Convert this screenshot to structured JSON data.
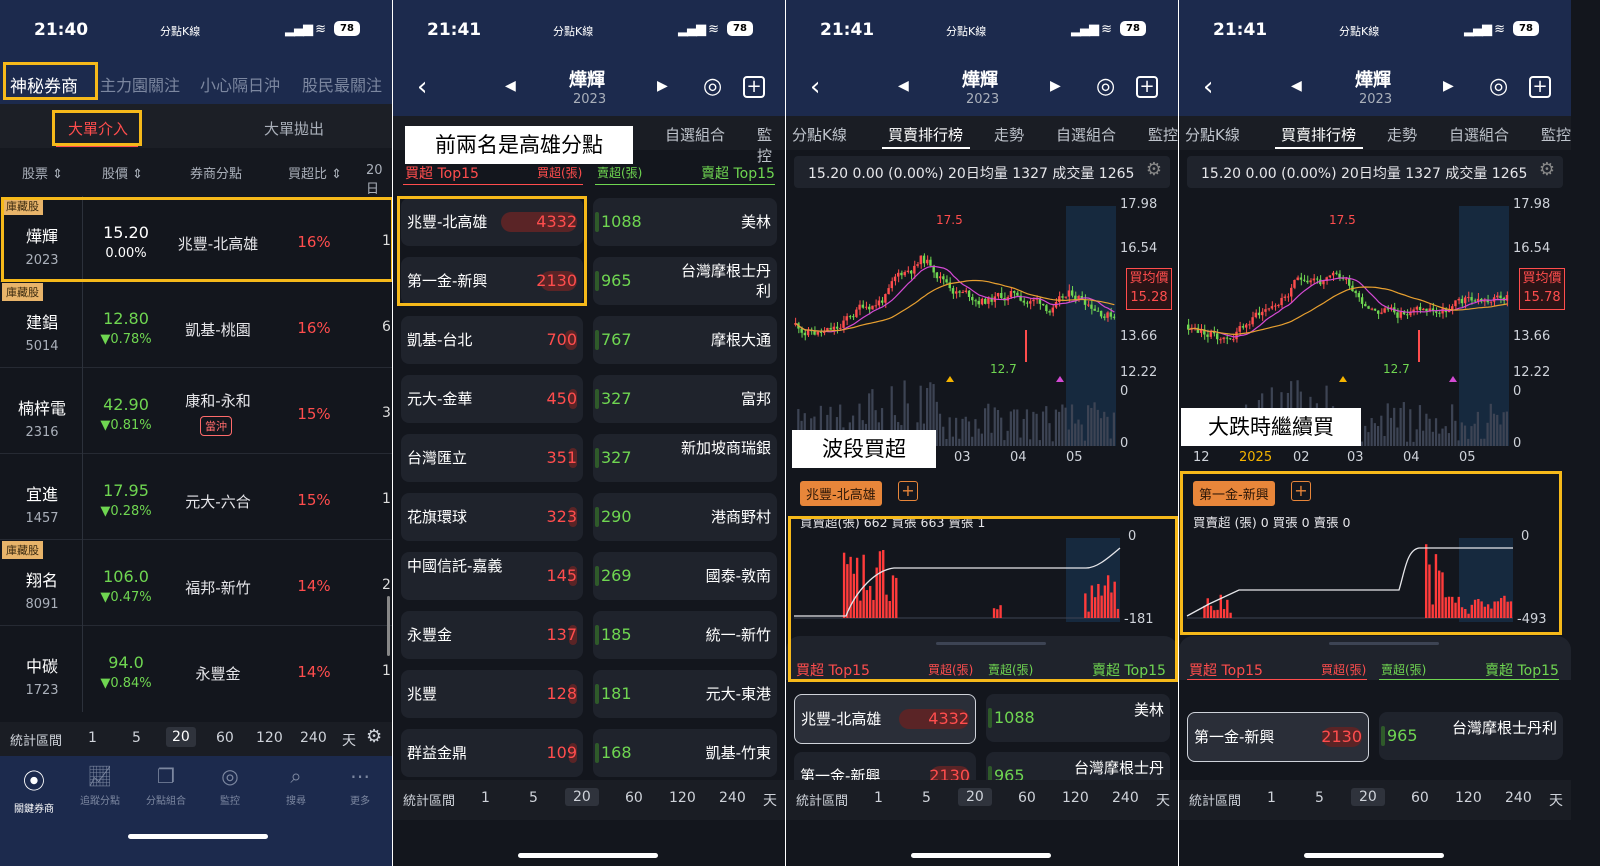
{
  "status": {
    "time1": "21:40",
    "time2": "21:41",
    "app": "分點K線",
    "battery": "78",
    "signal": "▂▄▆ ≋"
  },
  "p1": {
    "tabs": [
      "神秘券商",
      "主力園關注",
      "小心隔日沖",
      "股民最關注"
    ],
    "subtabs": [
      "大單介入",
      "大單拋出"
    ],
    "headers": [
      "股票 ⇕",
      "股價 ⇕",
      "券商分點",
      "買超比 ⇕",
      "20日"
    ],
    "rows": [
      {
        "tag": "庫藏股",
        "name": "燁輝",
        "code": "2023",
        "price": "15.20",
        "chg": "0.00%",
        "broker": "兆豐-北高雄",
        "ratio": "16%",
        "extra": "1:"
      },
      {
        "tag": "庫藏股",
        "name": "建錩",
        "code": "5014",
        "price": "12.80",
        "chg": "▼0.78%",
        "broker": "凱基-桃園",
        "ratio": "16%",
        "extra": "6"
      },
      {
        "tag": "",
        "name": "楠梓電",
        "code": "2316",
        "price": "42.90",
        "chg": "▼0.81%",
        "broker": "康和-永和",
        "badge": "當沖",
        "ratio": "15%",
        "extra": "3"
      },
      {
        "tag": "",
        "name": "宜進",
        "code": "1457",
        "price": "17.95",
        "chg": "▼0.28%",
        "broker": "元大-六合",
        "ratio": "15%",
        "extra": "1"
      },
      {
        "tag": "庫藏股",
        "name": "翔名",
        "code": "8091",
        "price": "106.0",
        "chg": "▼0.47%",
        "broker": "福邦-新竹",
        "ratio": "14%",
        "extra": "2"
      },
      {
        "tag": "",
        "name": "中碳",
        "code": "1723",
        "price": "94.0",
        "chg": "▼0.84%",
        "broker": "永豐金",
        "ratio": "14%",
        "extra": "1"
      }
    ],
    "period_label": "統計區間",
    "periods": [
      "1",
      "5",
      "20",
      "60",
      "120",
      "240",
      "天"
    ],
    "nav": [
      "關鍵券商",
      "追蹤分點",
      "分點組合",
      "監控",
      "搜尋",
      "更多"
    ]
  },
  "stock": {
    "name": "燁輝",
    "code": "2023"
  },
  "p2": {
    "note": "前兩名是高雄分點",
    "tabs": [
      "自選組合",
      "監控"
    ],
    "hdr": [
      "賣超 Top15",
      "買超(張)",
      "賣超(張)",
      "賣超 Top15"
    ],
    "buy": [
      {
        "n": "兆豐-北高雄",
        "v": "4332"
      },
      {
        "n": "第一金-新興",
        "v": "2130"
      },
      {
        "n": "凱基-台北",
        "v": "700"
      },
      {
        "n": "元大-金華",
        "v": "450"
      },
      {
        "n": "台灣匯立",
        "v": "351"
      },
      {
        "n": "花旗環球",
        "v": "323"
      },
      {
        "n": "中國信託-嘉義",
        "v": "145"
      },
      {
        "n": "永豐金",
        "v": "137"
      },
      {
        "n": "兆豐",
        "v": "128"
      },
      {
        "n": "群益金鼎",
        "v": "109"
      }
    ],
    "sell": [
      {
        "v": "1088",
        "n": "美林"
      },
      {
        "v": "965",
        "n": "台灣摩根士丹利"
      },
      {
        "v": "767",
        "n": "摩根大通"
      },
      {
        "v": "327",
        "n": "富邦"
      },
      {
        "v": "327",
        "n": "新加坡商瑞銀"
      },
      {
        "v": "290",
        "n": "港商野村"
      },
      {
        "v": "269",
        "n": "國泰-敦南"
      },
      {
        "v": "185",
        "n": "統一-新竹"
      },
      {
        "v": "181",
        "n": "元大-東港"
      },
      {
        "v": "168",
        "n": "凱基-竹東"
      }
    ]
  },
  "chart": {
    "tabs": [
      "分點K線",
      "買賣排行榜",
      "走勢",
      "自選組合",
      "監控"
    ],
    "info": "15.20  0.00 (0.00%) 20日均量 1327 成交量 1265",
    "y": [
      "17.98",
      "16.54",
      "13.66",
      "12.22",
      "0",
      "0"
    ],
    "y3": [
      "17.98",
      "16.54",
      "13.66",
      "12.22",
      "0",
      "0"
    ],
    "hi": "17.5",
    "lo": "12.7",
    "avg_label": "買均價",
    "avg3": "15.28",
    "avg4": "15.78",
    "x3": [
      "03",
      "04",
      "05"
    ],
    "x4": [
      "12",
      "2025",
      "02",
      "03",
      "04",
      "05"
    ],
    "hdr": [
      "買超 Top15",
      "買超(張)",
      "賣超(張)",
      "賣超 Top15"
    ]
  },
  "p3": {
    "note": "波段買超",
    "broker": "兆豐-北高雄",
    "stats": "買賣超(張) 662 買張 663 賣張 1",
    "top": "0",
    "bot": "-181",
    "c1": {
      "n": "兆豐-北高雄",
      "v": "4332"
    },
    "c2": {
      "v": "1088",
      "n": "美林"
    },
    "c3": {
      "n": "第一金-新興",
      "v": "2130"
    },
    "c4": {
      "v": "965",
      "n": "台灣摩根士丹"
    }
  },
  "p4": {
    "note": "大跌時繼續買",
    "broker": "第一金-新興",
    "stats": "買賣超 (張) 0 買張 0 賣張 0",
    "top": "0",
    "bot": "-493",
    "c1": {
      "n": "第一金-新興",
      "v": "2130"
    },
    "c2": {
      "v": "965",
      "n": "台灣摩根士丹利"
    }
  },
  "colors": {
    "up": "#ff4d4d",
    "down": "#6fd651",
    "accent": "#f6b91a",
    "navy": "#1c2a4d"
  }
}
